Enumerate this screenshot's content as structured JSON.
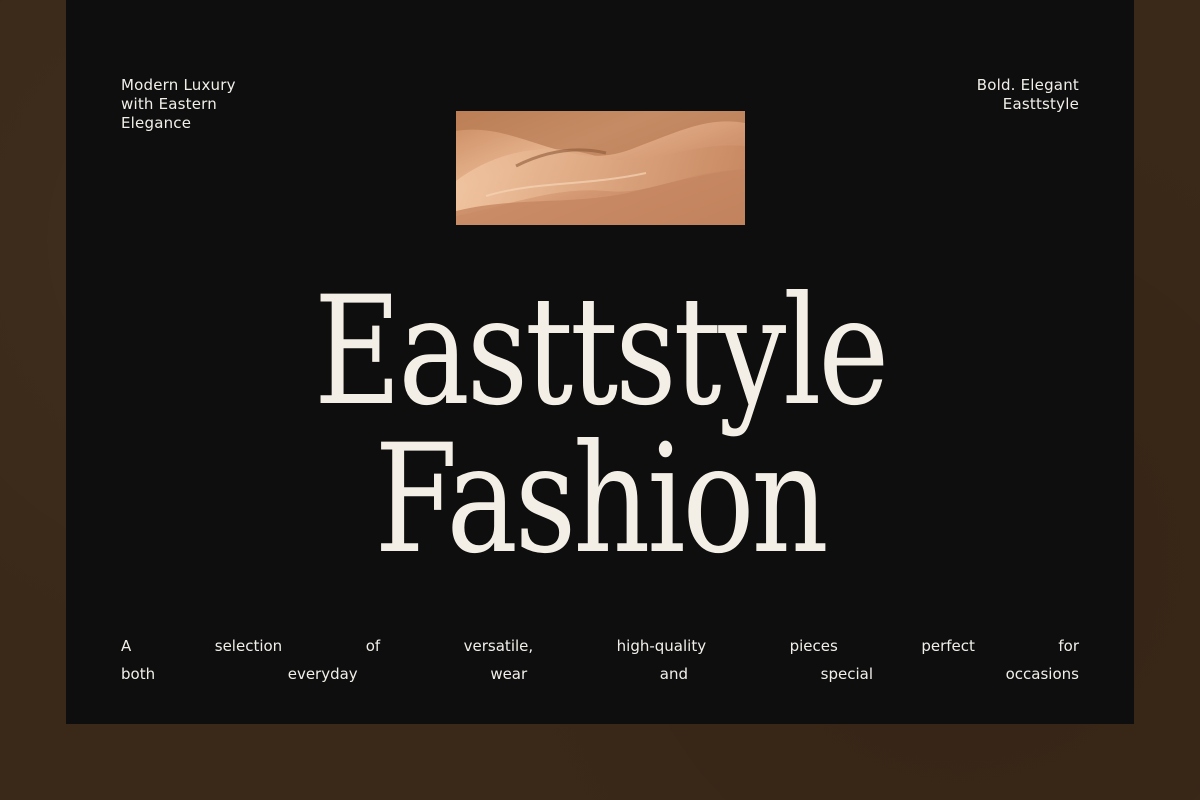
{
  "top_left": {
    "lines": [
      "Modern Luxury",
      "with Eastern",
      "Elegance"
    ]
  },
  "top_right": {
    "lines": [
      "Bold. Elegant",
      "Easttstyle"
    ]
  },
  "headline": {
    "line1": "Easttstyle",
    "line2": "Fashion"
  },
  "tagline": {
    "line1": [
      "A",
      "selection",
      "of",
      "versatile,",
      "high-quality",
      "pieces",
      "perfect",
      "for"
    ],
    "line2": [
      "both",
      "everyday",
      "wear",
      "and",
      "special",
      "occasions"
    ]
  },
  "colors": {
    "frame": "#3a2818",
    "card": "#0e0e0e",
    "text": "#f4efe6",
    "fabric": "#d9a07a"
  },
  "images": {
    "fabric_swatch": "silk-fabric-image"
  }
}
